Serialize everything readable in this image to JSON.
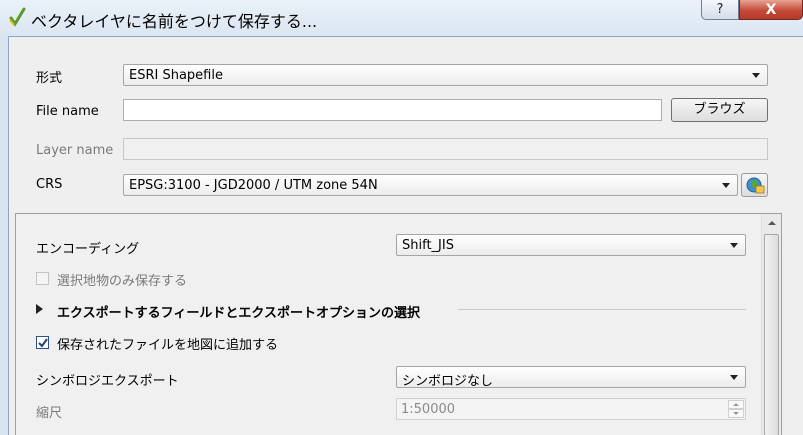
{
  "window": {
    "title": "ベクタレイヤに名前をつけて保存する...",
    "help_label": "?",
    "close_label": "X",
    "app_icon": "qgis-icon"
  },
  "form": {
    "format_label": "形式",
    "format_value": "ESRI Shapefile",
    "filename_label": "File name",
    "filename_value": "",
    "browse_label": "ブラウズ",
    "layername_label": "Layer name",
    "layername_value": "",
    "crs_label": "CRS",
    "crs_value": "EPSG:3100 - JGD2000 / UTM zone 54N",
    "crs_button_icon": "globe-icon"
  },
  "options": {
    "encoding_label": "エンコーディング",
    "encoding_value": "Shift_JIS",
    "selected_only_label": "選択地物のみ保存する",
    "selected_only_checked": false,
    "fields_section_label": "エクスポートするフィールドとエクスポートオプションの選択",
    "add_to_map_label": "保存されたファイルを地図に追加する",
    "add_to_map_checked": true,
    "symbology_label": "シンボロジエクスポート",
    "symbology_value": "シンボロジなし",
    "scale_label": "縮尺",
    "scale_value": "1:50000"
  }
}
